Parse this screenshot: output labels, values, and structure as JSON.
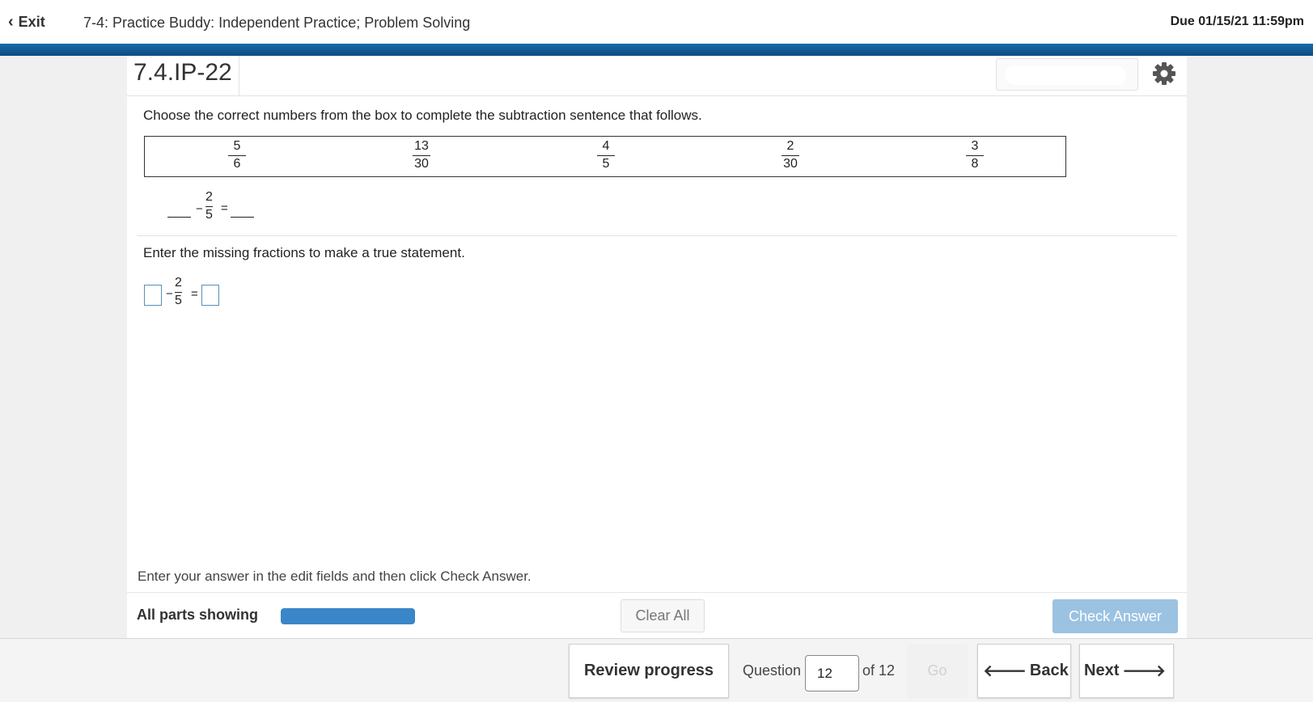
{
  "header": {
    "exit_label": "Exit",
    "assignment_title": "7-4: Practice Buddy: Independent Practice; Problem Solving",
    "due_text": "Due 01/15/21 11:59pm"
  },
  "question": {
    "id": "7.4.IP-22",
    "instruction": "Choose the correct numbers from the box to complete the subtraction sentence that follows.",
    "choices": [
      {
        "num": "5",
        "den": "6"
      },
      {
        "num": "13",
        "den": "30"
      },
      {
        "num": "4",
        "den": "5"
      },
      {
        "num": "2",
        "den": "30"
      },
      {
        "num": "3",
        "den": "8"
      }
    ],
    "given_fraction": {
      "num": "2",
      "den": "5"
    },
    "minus_sign": "−",
    "equals_sign": "=",
    "entry_instruction": "Enter the missing fractions to make a true statement.",
    "answer_1": "",
    "answer_2": ""
  },
  "footer": {
    "hint": "Enter your answer in the edit fields and then click Check Answer.",
    "parts_label": "All parts showing",
    "progress_fraction": 1.0,
    "clear_all_label": "Clear All",
    "check_answer_label": "Check Answer"
  },
  "nav": {
    "review_label": "Review progress",
    "question_label": "Question",
    "question_value": "12",
    "of_label": "of 12",
    "go_label": "Go",
    "back_label": "Back",
    "next_label": "Next"
  },
  "colors": {
    "brand_blue": "#0c4c82",
    "progress_blue": "#3a86c8",
    "check_button_disabled": "#9cc2e2"
  },
  "icons": {
    "exit": "chevron-left-icon",
    "settings": "gear-icon",
    "back": "arrow-left-icon",
    "next": "arrow-right-icon"
  }
}
